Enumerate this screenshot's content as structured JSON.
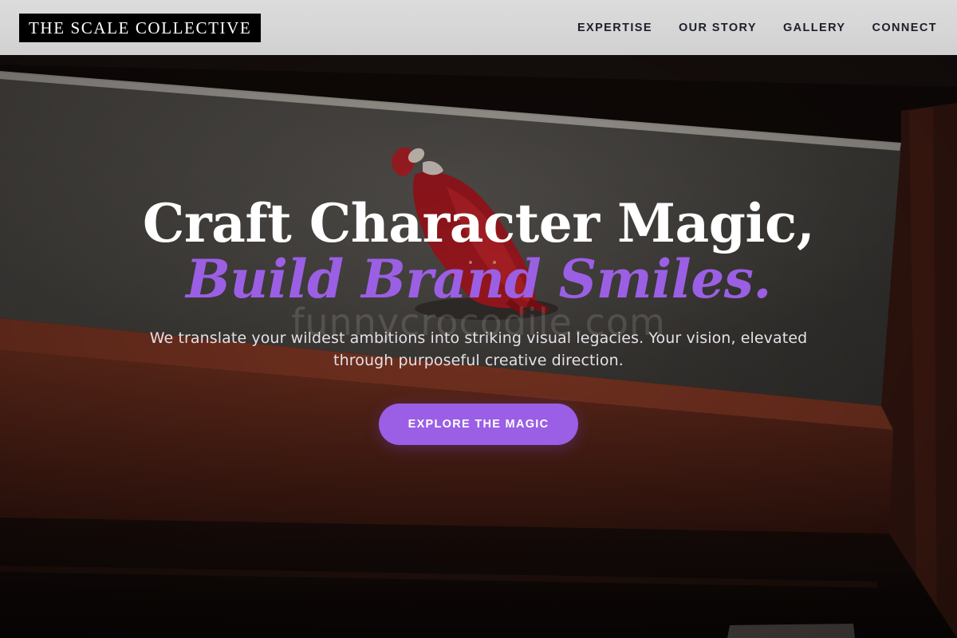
{
  "header": {
    "logo": "THE SCALE COLLECTIVE",
    "nav": [
      "EXPERTISE",
      "OUR STORY",
      "GALLERY",
      "CONNECT"
    ]
  },
  "hero": {
    "title_line1": "Craft Character Magic,",
    "title_line2": "Build Brand Smiles.",
    "subtitle": "We translate your wildest ambitions into striking visual legacies. Your vision, elevated through purposeful creative direction.",
    "cta_label": "EXPLORE THE MAGIC",
    "watermark": "funnycrocodile.com"
  },
  "colors": {
    "accent": "#9a5fe4",
    "header_bg": "#d6d6d6",
    "logo_bg": "#000000",
    "nav_text": "#1c1f2a",
    "figure_red": "#b01a22"
  },
  "icons": {
    "hero_image": "red-costumed-figure-on-ledge-photo"
  }
}
